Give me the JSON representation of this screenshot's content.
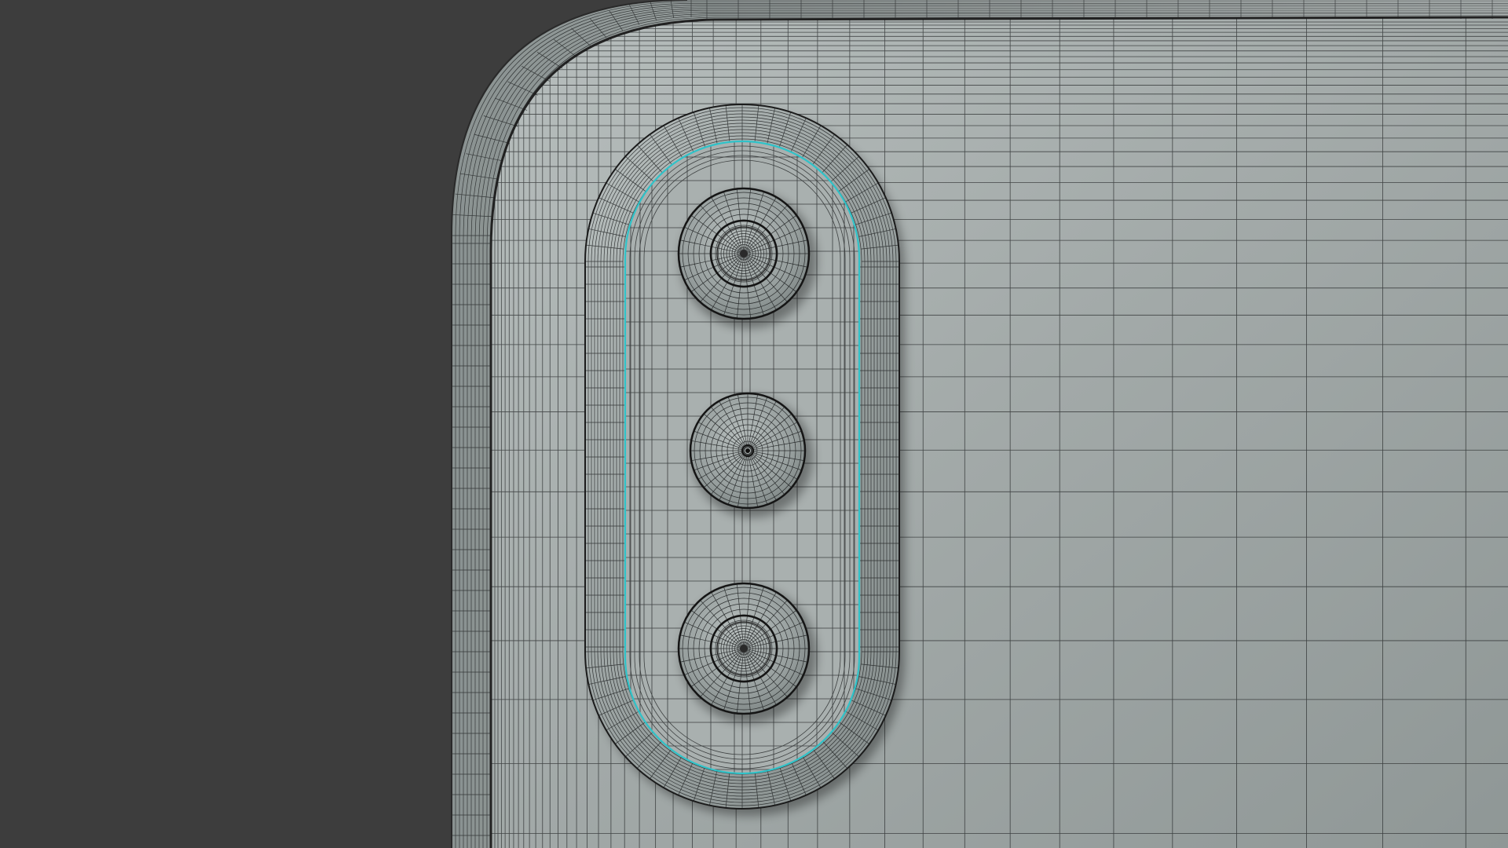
{
  "viewport": {
    "background_color": "#3d3d3d"
  },
  "model": {
    "subject": "phone-back-camera-module",
    "body_color": "#98a09f",
    "body_highlight": "#b3bab9",
    "wire_color": "#17191a",
    "selection_edge_color": "#2fc3c9",
    "camera_lenses": [
      {
        "name": "top-lens",
        "type": "lens"
      },
      {
        "name": "middle-flash",
        "type": "flash"
      },
      {
        "name": "bottom-lens",
        "type": "lens"
      }
    ]
  }
}
